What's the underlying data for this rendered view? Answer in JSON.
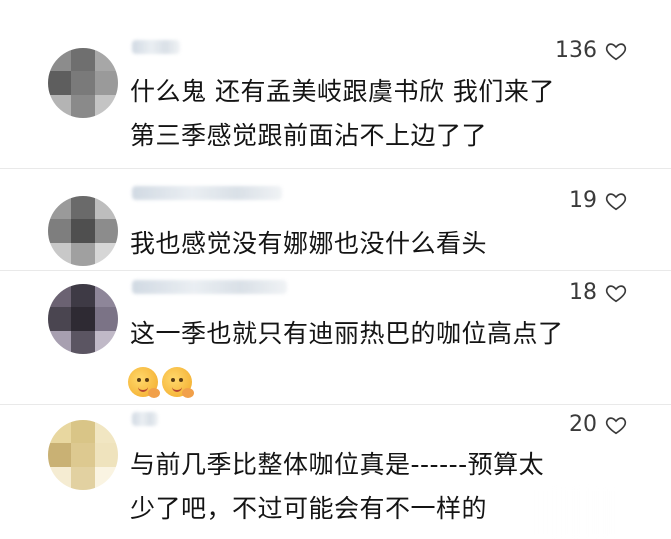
{
  "colors": {
    "text": "#141414",
    "meta": "#3a3a3a",
    "divider": "#e9e9e9"
  },
  "icons": {
    "like": "heart-outline-icon"
  },
  "comments": [
    {
      "likes": "136",
      "text": "什么鬼 还有孟美岐跟虞书欣 我们来了\n第三季感觉跟前面沾不上边了了"
    },
    {
      "likes": "19",
      "text": "我也感觉没有娜娜也没什么看头"
    },
    {
      "likes": "18",
      "text": "这一季也就只有迪丽热巴的咖位高点了",
      "emojis": [
        "smirk-emoji",
        "smirk-emoji"
      ]
    },
    {
      "likes": "20",
      "text": "与前几季比整体咖位真是------预算太\n少了吧，不过可能会有不一样的"
    }
  ]
}
